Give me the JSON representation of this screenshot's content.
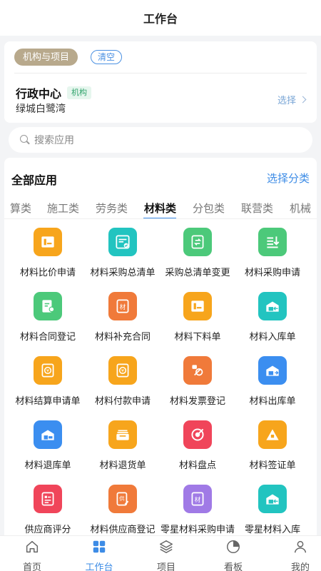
{
  "header": {
    "title": "工作台"
  },
  "org_card": {
    "tag_label": "机构与项目",
    "clear_label": "清空",
    "org_name": "行政中心",
    "org_badge": "机构",
    "project_name": "绿城白鹭湾",
    "select_label": "选择"
  },
  "search": {
    "placeholder": "搜索应用"
  },
  "apps_section": {
    "title": "全部应用",
    "choose_category": "选择分类",
    "tabs": [
      {
        "label": "算类",
        "active": false
      },
      {
        "label": "施工类",
        "active": false
      },
      {
        "label": "劳务类",
        "active": false
      },
      {
        "label": "材料类",
        "active": true
      },
      {
        "label": "分包类",
        "active": false
      },
      {
        "label": "联营类",
        "active": false
      },
      {
        "label": "机械",
        "active": false
      }
    ],
    "apps": [
      {
        "label": "材料比价申请",
        "color": "#f7a51c",
        "icon": "document-icon"
      },
      {
        "label": "材料采购总清单",
        "color": "#22c4c0",
        "icon": "checklist-icon"
      },
      {
        "label": "采购总清单变更",
        "color": "#4cc97a",
        "icon": "swap-document-icon"
      },
      {
        "label": "材料采购申请",
        "color": "#4cc97a",
        "icon": "download-list-icon"
      },
      {
        "label": "材料合同登记",
        "color": "#4cc97a",
        "icon": "contract-icon"
      },
      {
        "label": "材料补充合同",
        "color": "#f07a3a",
        "icon": "material-doc-icon"
      },
      {
        "label": "材料下料单",
        "color": "#f7a51c",
        "icon": "document-icon"
      },
      {
        "label": "材料入库单",
        "color": "#22c4c0",
        "icon": "warehouse-in-icon"
      },
      {
        "label": "材料结算申请单",
        "color": "#f7a51c",
        "icon": "yen-doc-icon"
      },
      {
        "label": "材料付款申请",
        "color": "#f7a51c",
        "icon": "yen-doc-icon"
      },
      {
        "label": "材料发票登记",
        "color": "#f07a3a",
        "icon": "invoice-icon"
      },
      {
        "label": "材料出库单",
        "color": "#3b8ef0",
        "icon": "warehouse-out-icon"
      },
      {
        "label": "材料退库单",
        "color": "#3b8ef0",
        "icon": "warehouse-return-icon"
      },
      {
        "label": "材料退货单",
        "color": "#f7a51c",
        "icon": "tray-icon"
      },
      {
        "label": "材料盘点",
        "color": "#f0455a",
        "icon": "target-icon"
      },
      {
        "label": "材料签证单",
        "color": "#f7a51c",
        "icon": "triangle-icon"
      },
      {
        "label": "供应商评分",
        "color": "#f0455a",
        "icon": "score-icon"
      },
      {
        "label": "材料供应商登记",
        "color": "#f07a3a",
        "icon": "supplier-icon"
      },
      {
        "label": "零星材料采购申请",
        "color": "#a07ae6",
        "icon": "material-doc-icon"
      },
      {
        "label": "零星材料入库",
        "color": "#22c4c0",
        "icon": "warehouse-in-icon"
      }
    ]
  },
  "tabbar": {
    "items": [
      {
        "label": "首页",
        "icon": "home-icon",
        "active": false
      },
      {
        "label": "工作台",
        "icon": "grid-icon",
        "active": true
      },
      {
        "label": "项目",
        "icon": "layers-icon",
        "active": false
      },
      {
        "label": "看板",
        "icon": "pie-chart-icon",
        "active": false
      },
      {
        "label": "我的",
        "icon": "user-icon",
        "active": false
      }
    ],
    "active_color": "#3d8ce6"
  }
}
